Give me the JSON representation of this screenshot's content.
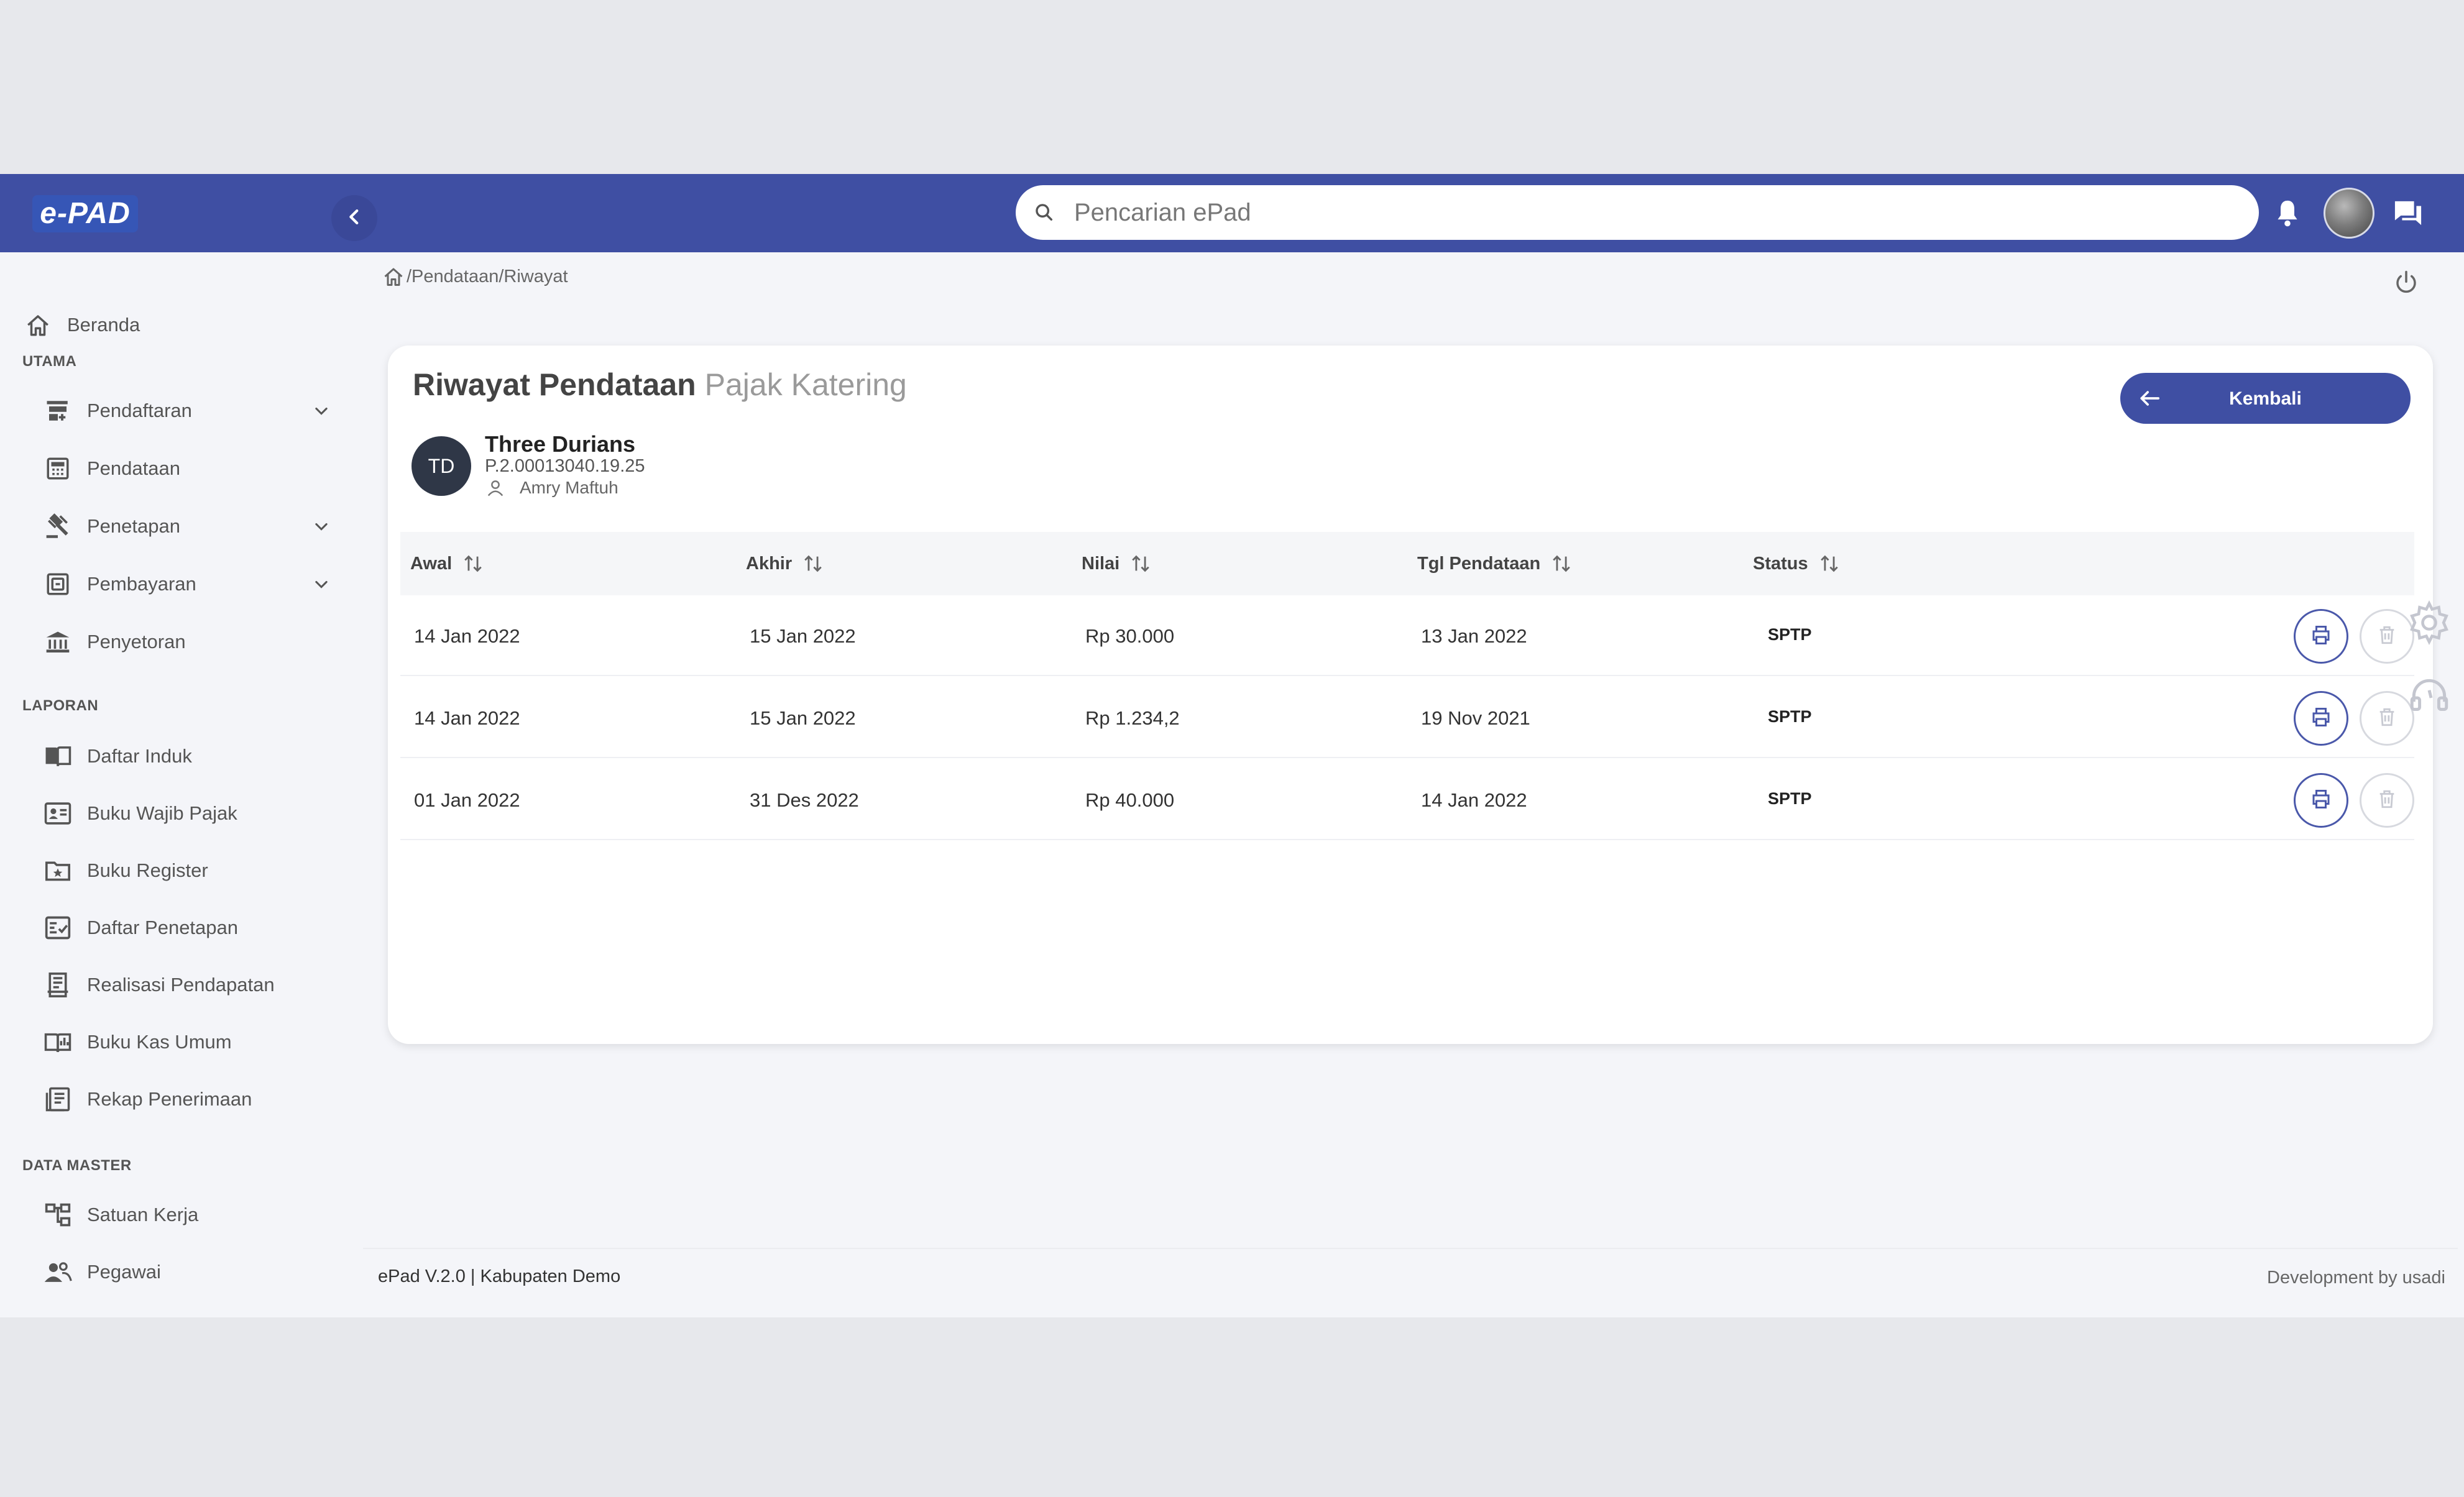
{
  "header": {
    "logo_text": "e-PAD",
    "search_placeholder": "Pencarian ePad"
  },
  "sidebar": {
    "home_label": "Beranda",
    "sections": {
      "utama": "UTAMA",
      "laporan": "LAPORAN",
      "data_master": "DATA MASTER"
    },
    "utama_items": [
      {
        "label": "Pendaftaran",
        "icon": "register-cart-icon",
        "has_submenu": true
      },
      {
        "label": "Pendataan",
        "icon": "calculator-icon",
        "has_submenu": false
      },
      {
        "label": "Penetapan",
        "icon": "gavel-icon",
        "has_submenu": true
      },
      {
        "label": "Pembayaran",
        "icon": "payment-icon",
        "has_submenu": true
      },
      {
        "label": "Penyetoran",
        "icon": "bank-icon",
        "has_submenu": false
      }
    ],
    "laporan_items": [
      {
        "label": "Daftar Induk",
        "icon": "book-open-icon"
      },
      {
        "label": "Buku Wajib Pajak",
        "icon": "id-card-icon"
      },
      {
        "label": "Buku Register",
        "icon": "folder-star-icon"
      },
      {
        "label": "Daftar Penetapan",
        "icon": "checklist-icon"
      },
      {
        "label": "Realisasi Pendapatan",
        "icon": "receipt-icon"
      },
      {
        "label": "Buku Kas Umum",
        "icon": "book-chart-icon"
      },
      {
        "label": "Rekap Penerimaan",
        "icon": "document-list-icon"
      }
    ],
    "data_master_items": [
      {
        "label": "Satuan Kerja",
        "icon": "org-chart-icon"
      },
      {
        "label": "Pegawai",
        "icon": "people-icon"
      }
    ]
  },
  "breadcrumb": {
    "path": "/Pendataan/Riwayat"
  },
  "card": {
    "title_main": "Riwayat Pendataan",
    "title_sub": "Pajak Katering",
    "back_label": "Kembali",
    "entity": {
      "initials": "TD",
      "name": "Three Durians",
      "code": "P.2.00013040.19.25",
      "owner": "Amry Maftuh"
    },
    "columns": [
      "Awal",
      "Akhir",
      "Nilai",
      "Tgl Pendataan",
      "Status"
    ],
    "rows": [
      {
        "awal": "14 Jan 2022",
        "akhir": "15 Jan 2022",
        "nilai": "Rp 30.000",
        "tgl": "13 Jan 2022",
        "status": "SPTP"
      },
      {
        "awal": "14 Jan 2022",
        "akhir": "15 Jan 2022",
        "nilai": "Rp 1.234,2",
        "tgl": "19 Nov 2021",
        "status": "SPTP"
      },
      {
        "awal": "01 Jan 2022",
        "akhir": "31 Des 2022",
        "nilai": "Rp 40.000",
        "tgl": "14 Jan 2022",
        "status": "SPTP"
      }
    ]
  },
  "footer": {
    "version": "ePad V.2.0 | Kabupaten Demo",
    "credit": "Development by usadi"
  },
  "colors": {
    "primary": "#3f4fa3",
    "background": "#f4f5f9",
    "outer": "#e7e8ec"
  }
}
